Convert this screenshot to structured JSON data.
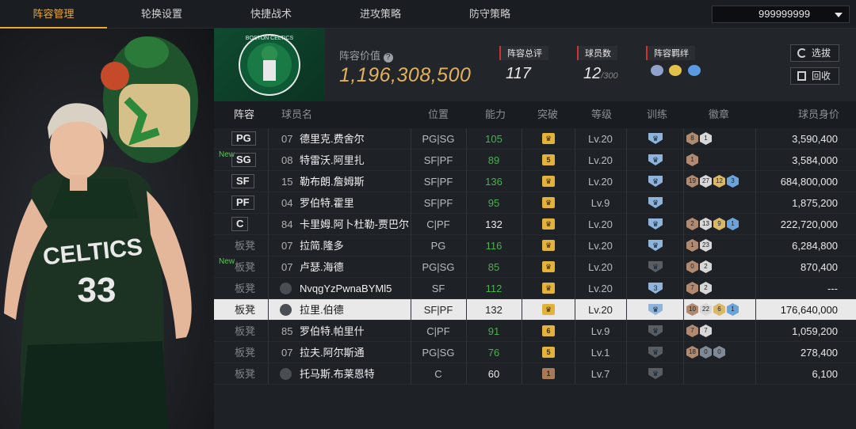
{
  "nav": {
    "tabs": [
      "阵容管理",
      "轮换设置",
      "快捷战术",
      "进攻策略",
      "防守策略"
    ],
    "active_index": 0,
    "coins": "999999999"
  },
  "summary": {
    "value_label": "阵容价值",
    "value": "1,196,308,500",
    "rating_label": "阵容总评",
    "rating": "117",
    "count_label": "球员数",
    "count": "12",
    "count_max": "/300",
    "bond_label": "阵容羁绊",
    "select_btn": "选拔",
    "recycle_btn": "回收"
  },
  "headers": {
    "lineup": "阵容",
    "name": "球员名",
    "position": "位置",
    "ability": "能力",
    "breakthrough": "突破",
    "level": "等级",
    "training": "训练",
    "badges": "徽章",
    "value": "球员身价"
  },
  "players": [
    {
      "slot": "PG",
      "new": "",
      "num": "07",
      "name": "德里克.费舍尔",
      "pos": "PG|SG",
      "ability": "105",
      "brk": "",
      "brk_color": "#e3b23c",
      "level": "Lv.20",
      "train": "",
      "train_color": "#8fb3d9",
      "badges": [
        "8",
        "1"
      ],
      "badge_colors": [
        "#b08a70",
        "#d7d7d7"
      ],
      "value": "3,590,400"
    },
    {
      "slot": "SG",
      "new": "New",
      "num": "08",
      "name": "特雷沃.阿里扎",
      "pos": "SF|PF",
      "ability": "89",
      "brk": "5",
      "brk_color": "#e3b23c",
      "level": "Lv.20",
      "train": "",
      "train_color": "#8fb3d9",
      "badges": [
        "1"
      ],
      "badge_colors": [
        "#b08a70"
      ],
      "value": "3,584,000"
    },
    {
      "slot": "SF",
      "new": "",
      "num": "15",
      "name": "勒布朗.詹姆斯",
      "pos": "SF|PF",
      "ability": "136",
      "brk": "",
      "brk_color": "#e3b23c",
      "level": "Lv.20",
      "train": "",
      "train_color": "#8fb3d9",
      "badges": [
        "19",
        "27",
        "12",
        "3"
      ],
      "badge_colors": [
        "#b08a70",
        "#d7d7d7",
        "#d9b86a",
        "#6aa4d9"
      ],
      "value": "684,800,000"
    },
    {
      "slot": "PF",
      "new": "",
      "num": "04",
      "name": "罗伯特.霍里",
      "pos": "SF|PF",
      "ability": "95",
      "brk": "",
      "brk_color": "#e3b23c",
      "level": "Lv.9",
      "train": "",
      "train_color": "#8fb3d9",
      "badges": [],
      "badge_colors": [],
      "value": "1,875,200"
    },
    {
      "slot": "C",
      "new": "",
      "num": "84",
      "name": "卡里姆.阿卜杜勒-贾巴尔",
      "pos": "C|PF",
      "ability": "132",
      "brk": "",
      "brk_color": "#e3b23c",
      "level": "Lv.20",
      "train": "",
      "train_color": "#8fb3d9",
      "badges": [
        "2",
        "13",
        "9",
        "1"
      ],
      "badge_colors": [
        "#b08a70",
        "#d7d7d7",
        "#d9b86a",
        "#6aa4d9"
      ],
      "value": "222,720,000"
    },
    {
      "slot": "板凳",
      "new": "",
      "num": "07",
      "name": "拉简.隆多",
      "pos": "PG",
      "ability": "116",
      "brk": "",
      "brk_color": "#e3b23c",
      "level": "Lv.20",
      "train": "",
      "train_color": "#8fb3d9",
      "badges": [
        "1",
        "23"
      ],
      "badge_colors": [
        "#b08a70",
        "#d7d7d7"
      ],
      "value": "6,284,800"
    },
    {
      "slot": "板凳",
      "new": "New",
      "num": "07",
      "name": "卢瑟.海德",
      "pos": "PG|SG",
      "ability": "85",
      "brk": "",
      "brk_color": "#e3b23c",
      "level": "Lv.20",
      "train": "",
      "train_color": "#5a5e63",
      "badges": [
        "0",
        "2"
      ],
      "badge_colors": [
        "#b08a70",
        "#d7d7d7"
      ],
      "value": "870,400"
    },
    {
      "slot": "板凳",
      "new": "",
      "num": "",
      "name": "NvqgYzPwnaBYMl5",
      "pos": "SF",
      "ability": "112",
      "brk": "",
      "brk_color": "#e3b23c",
      "level": "Lv.20",
      "train": "3",
      "train_color": "#8fb3d9",
      "badges": [
        "7",
        "2"
      ],
      "badge_colors": [
        "#b08a70",
        "#d7d7d7"
      ],
      "value": "---"
    },
    {
      "slot": "板凳",
      "new": "",
      "num": "",
      "name": "拉里.伯德",
      "pos": "SF|PF",
      "ability": "132",
      "brk": "",
      "brk_color": "#e3b23c",
      "level": "Lv.20",
      "train": "",
      "train_color": "#8fb3d9",
      "badges": [
        "10",
        "22",
        "6",
        "1"
      ],
      "badge_colors": [
        "#b08a70",
        "#d7d7d7",
        "#d9b86a",
        "#6aa4d9"
      ],
      "value": "176,640,000"
    },
    {
      "slot": "板凳",
      "new": "",
      "num": "85",
      "name": "罗伯特.帕里什",
      "pos": "C|PF",
      "ability": "91",
      "brk": "6",
      "brk_color": "#e3b23c",
      "level": "Lv.9",
      "train": "",
      "train_color": "#5a5e63",
      "badges": [
        "7",
        "7"
      ],
      "badge_colors": [
        "#b08a70",
        "#d7d7d7"
      ],
      "value": "1,059,200"
    },
    {
      "slot": "板凳",
      "new": "",
      "num": "07",
      "name": "拉夫.阿尔斯通",
      "pos": "PG|SG",
      "ability": "76",
      "brk": "5",
      "brk_color": "#e3b23c",
      "level": "Lv.1",
      "train": "",
      "train_color": "#5a5e63",
      "badges": [
        "18",
        "0",
        "0"
      ],
      "badge_colors": [
        "#b08a70",
        "#7f8a96",
        "#7f8a96"
      ],
      "value": "278,400"
    },
    {
      "slot": "板凳",
      "new": "",
      "num": "",
      "name": "托马斯.布莱恩特",
      "pos": "C",
      "ability": "60",
      "brk": "1",
      "brk_color": "#a87a5a",
      "level": "Lv.7",
      "train": "",
      "train_color": "#5a5e63",
      "badges": [],
      "badge_colors": [],
      "value": "6,100"
    }
  ],
  "selected_row": 8,
  "hero_text": {
    "jersey_team": "CELTICS",
    "jersey_number": "33",
    "logo_text": "BOSTON CELTICS"
  }
}
